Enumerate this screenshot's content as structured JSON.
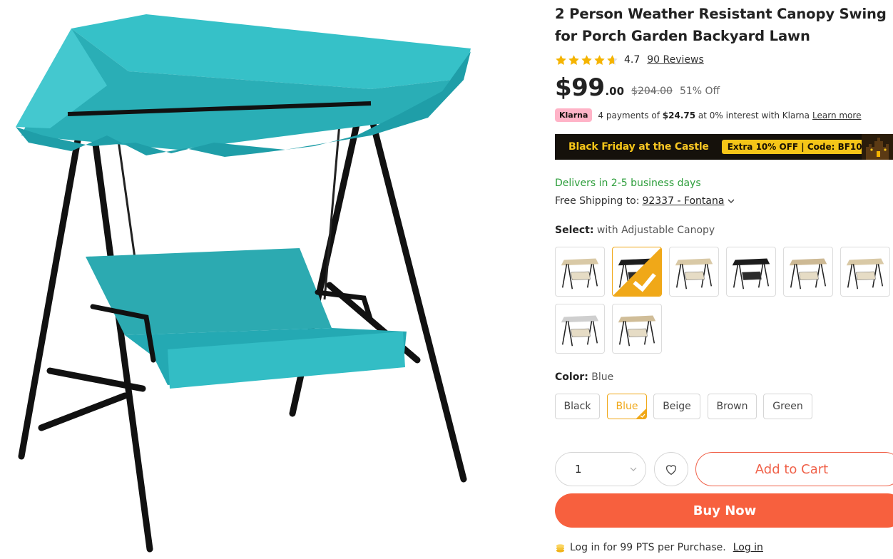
{
  "product": {
    "title": "2 Person Weather Resistant Canopy Swing for Porch Garden Backyard Lawn",
    "image_alt_icon": "canopy-swing-image"
  },
  "rating": {
    "value": "4.7",
    "stars": 4.7,
    "reviews_label": "90 Reviews",
    "star_color": "#f5b400"
  },
  "price": {
    "main": "$99",
    "cents": ".00",
    "original": "$204.00",
    "discount": "51% Off"
  },
  "klarna": {
    "badge": "Klarna",
    "prefix": "4 payments of",
    "amount": "$24.75",
    "suffix": "at 0% interest with Klarna",
    "learn_more": "Learn more"
  },
  "promo": {
    "text_bold": "Black Friday",
    "text_rest": "at the Castle",
    "tag": "Extra 10% OFF | Code: BF10"
  },
  "delivery": {
    "delivers": "Delivers in 2-5 business days",
    "shipping_prefix": "Free Shipping to:",
    "zip": "92337 - Fontana"
  },
  "select": {
    "label": "Select:",
    "value": "with Adjustable Canopy",
    "options": [
      {
        "name": "variant-1",
        "canopy": "#d9c9a6",
        "selected": false
      },
      {
        "name": "variant-2",
        "canopy": "#1c1c1c",
        "selected": true
      },
      {
        "name": "variant-3",
        "canopy": "#d9c9a6",
        "selected": false
      },
      {
        "name": "variant-4",
        "canopy": "#1c1c1c",
        "selected": false
      },
      {
        "name": "variant-5",
        "canopy": "#cdb994",
        "selected": false
      },
      {
        "name": "variant-6",
        "canopy": "#d9c9a6",
        "selected": false
      },
      {
        "name": "variant-7",
        "canopy": "#cfcfcf",
        "selected": false
      },
      {
        "name": "variant-8",
        "canopy": "#d0bd98",
        "selected": false
      }
    ]
  },
  "color": {
    "label": "Color:",
    "value": "Blue",
    "options": [
      "Black",
      "Blue",
      "Beige",
      "Brown",
      "Green"
    ],
    "selected_index": 1,
    "accent": "#f0a818"
  },
  "purchase": {
    "quantity": "1",
    "add_to_cart": "Add to Cart",
    "buy_now": "Buy Now",
    "buy_color": "#f7603e"
  },
  "points": {
    "text": "Log in for 99 PTS per Purchase.",
    "login": "Log in"
  }
}
